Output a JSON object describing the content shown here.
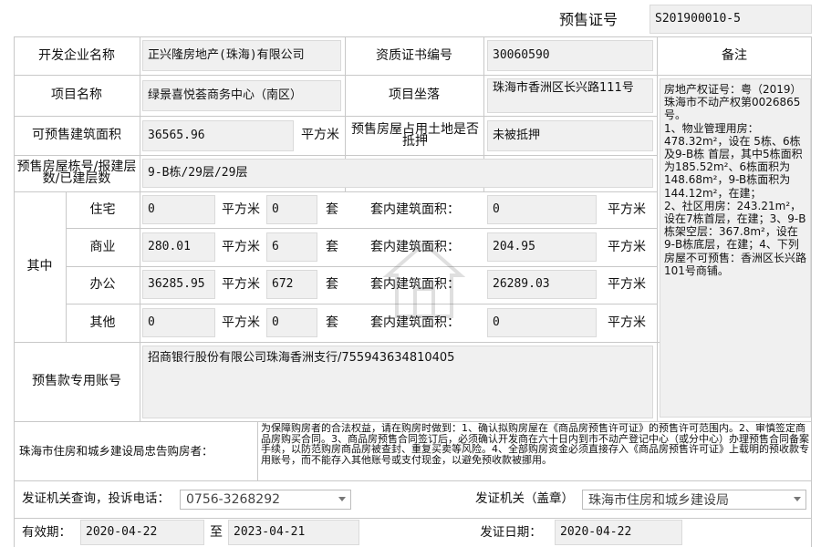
{
  "header": {
    "presale_label": "预售证号",
    "presale_no": "S201900010-5"
  },
  "row1": {
    "developer_label": "开发企业名称",
    "developer": "正兴隆房地产(珠海)有限公司",
    "qual_label": "资质证书编号",
    "qual_no": "30060590",
    "remark_label": "备注"
  },
  "row2": {
    "project_label": "项目名称",
    "project": "绿景喜悦荟商务中心（南区）",
    "location_label": "项目坐落",
    "location": "珠海市香洲区长兴路111号"
  },
  "row3": {
    "area_label": "可预售建筑面积",
    "area": "36565.96",
    "unit": "平方米",
    "mortgage_label": "预售房屋占用土地是否抵押",
    "mortgage": "未被抵押"
  },
  "row4": {
    "floors_label": "预售房屋栋号/报建层数/已建层数",
    "floors": "9-B栋/29层/29层"
  },
  "usage": {
    "group_label": "其中",
    "unit_area": "平方米",
    "unit_set": "套",
    "inner_label": "套内建筑面积：",
    "rows": [
      {
        "type": "住宅",
        "area": "0",
        "sets": "0",
        "inner": "0"
      },
      {
        "type": "商业",
        "area": "280.01",
        "sets": "6",
        "inner": "204.95"
      },
      {
        "type": "办公",
        "area": "36285.95",
        "sets": "672",
        "inner": "26289.03"
      },
      {
        "type": "其他",
        "area": "0",
        "sets": "0",
        "inner": "0"
      }
    ]
  },
  "remark": {
    "text": "房地产权证号：粤（2019）珠海市不动产权第0026865号。\n1、物业管理用房：478.32m²，设在 5栋、6栋及9-B栋 首层，其中5栋面积为185.52m²、6栋面积为148.68m²，9-B栋面积为144.12m²，在建；\n2、社区用房：243.21m²，设在7栋首层，在建；3、9-B栋架空层：367.8m²，设在9-B栋底层，在建；4、下列房屋不可预售：香洲区长兴路101号商铺。"
  },
  "account": {
    "label": "预售款专用账号",
    "value": "招商银行股份有限公司珠海香洲支行/755943634810405"
  },
  "notice": {
    "label": "珠海市住房和城乡建设局忠告购房者：",
    "text": "为保障购房者的合法权益，请在购房时做到：1、确认拟购房屋在《商品房预售许可证》的预售许可范围内。2、审慎签定商品房购买合同。3、商品房预售合同签订后，必须确认开发商在六十日内到市不动产登记中心（或分中心）办理预售合同备案手续，以防范购房商品房被查封、重复买卖等风险。4、全部购房资金必须直接存入《商品房预售许可证》上载明的预收款专用账号，而不能存入其他账号或支付现金，以避免预收款被挪用。"
  },
  "contact": {
    "label": "发证机关查询，投诉电话：",
    "phone": "0756-3268292",
    "authority_label": "发证机关（盖章）",
    "authority": "珠海市住房和城乡建设局"
  },
  "validity": {
    "label": "有效期：",
    "from": "2020-04-22",
    "to_label": "至",
    "to": "2023-04-21",
    "issue_label": "发证日期：",
    "issue": "2020-04-22"
  }
}
